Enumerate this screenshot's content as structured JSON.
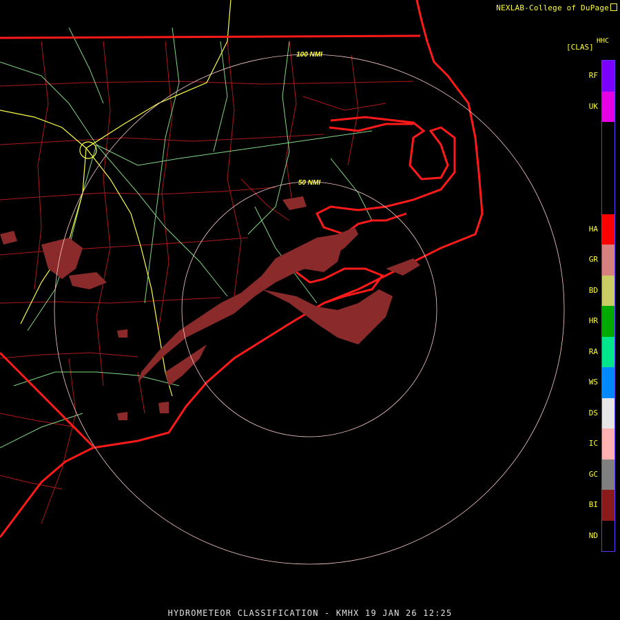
{
  "credit": "NEXLAB-College of DuPage",
  "legend": {
    "product": "HHC",
    "title": "[CLAS]",
    "items": [
      {
        "code": "RF",
        "color": "#7b00ff"
      },
      {
        "code": "UK",
        "color": "#e600e6"
      },
      {
        "code": "",
        "color": "#000000"
      },
      {
        "code": "",
        "color": "#000000"
      },
      {
        "code": "",
        "color": "#000000"
      },
      {
        "code": "HA",
        "color": "#ff0000"
      },
      {
        "code": "GR",
        "color": "#d88080"
      },
      {
        "code": "BD",
        "color": "#cccc66"
      },
      {
        "code": "HR",
        "color": "#00aa00"
      },
      {
        "code": "RA",
        "color": "#00e68c"
      },
      {
        "code": "WS",
        "color": "#0088ff"
      },
      {
        "code": "DS",
        "color": "#e6e6e6"
      },
      {
        "code": "IC",
        "color": "#ffb0b0"
      },
      {
        "code": "GC",
        "color": "#808080"
      },
      {
        "code": "BI",
        "color": "#8b1a1a"
      },
      {
        "code": "ND",
        "color": "#000000"
      }
    ]
  },
  "range_rings": {
    "inner_label": "50 NMI",
    "outer_label": "100 NMI"
  },
  "colors": {
    "state_border": "#ff1a1a",
    "county_line": "#b01818",
    "highway": "#99ff99",
    "interstate": "#ffff44",
    "ring": "#ffcccc",
    "echo": "#8b2a2a"
  },
  "footer": "HYDROMETEOR CLASSIFICATION - KMHX 19 JAN 26 12:25"
}
